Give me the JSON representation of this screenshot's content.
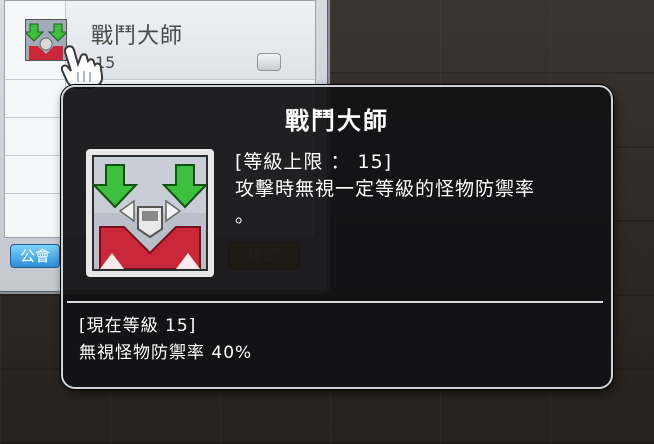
{
  "skill_window": {
    "selected_row": {
      "name": "戰鬥大師",
      "level": "15",
      "plus_button_icon": "plus-button-icon"
    },
    "guild_tab_label": "公會",
    "orange_button_label": "確認"
  },
  "tooltip": {
    "title": "戰鬥大師",
    "max_level_line": "[等級上限 ： 15]",
    "description_line1": "攻擊時無視一定等級的怪物防禦率",
    "description_line2": "。",
    "current_level_line": "[現在等級 15]",
    "current_effect_line": "無視怪物防禦率 40%"
  },
  "icons": {
    "skill": "skill-icon",
    "cursor": "hand-cursor-icon"
  },
  "colors": {
    "tooltip_background": "#121214",
    "tooltip_border": "#cfd2d6",
    "text": "#ffffff",
    "arrow_green": "#3fbf3f",
    "armor_red": "#c8283a"
  }
}
